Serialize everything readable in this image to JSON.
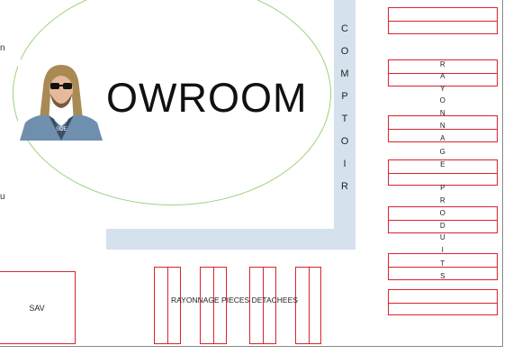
{
  "showroom": {
    "title": "OWROOM",
    "photo_caption": "SOE"
  },
  "counter": {
    "letters": [
      "C",
      "O",
      "M",
      "P",
      "T",
      "O",
      "I",
      "R"
    ]
  },
  "products_shelf": {
    "letters": [
      "R",
      "A",
      "Y",
      "O",
      "N",
      "N",
      "A",
      "G",
      "E",
      "",
      "P",
      "R",
      "O",
      "D",
      "U",
      "I",
      "T",
      "S"
    ]
  },
  "sav": {
    "label": "SAV"
  },
  "pieces": {
    "label": "RAYONNAGE PIECES DETACHEES"
  },
  "edge": {
    "top_glyph": "n",
    "bottom_glyph": "u"
  },
  "colors": {
    "shelf_border": "#d9232e",
    "counter_fill": "#d6e1ee",
    "ellipse_stroke": "#9bd17d"
  }
}
